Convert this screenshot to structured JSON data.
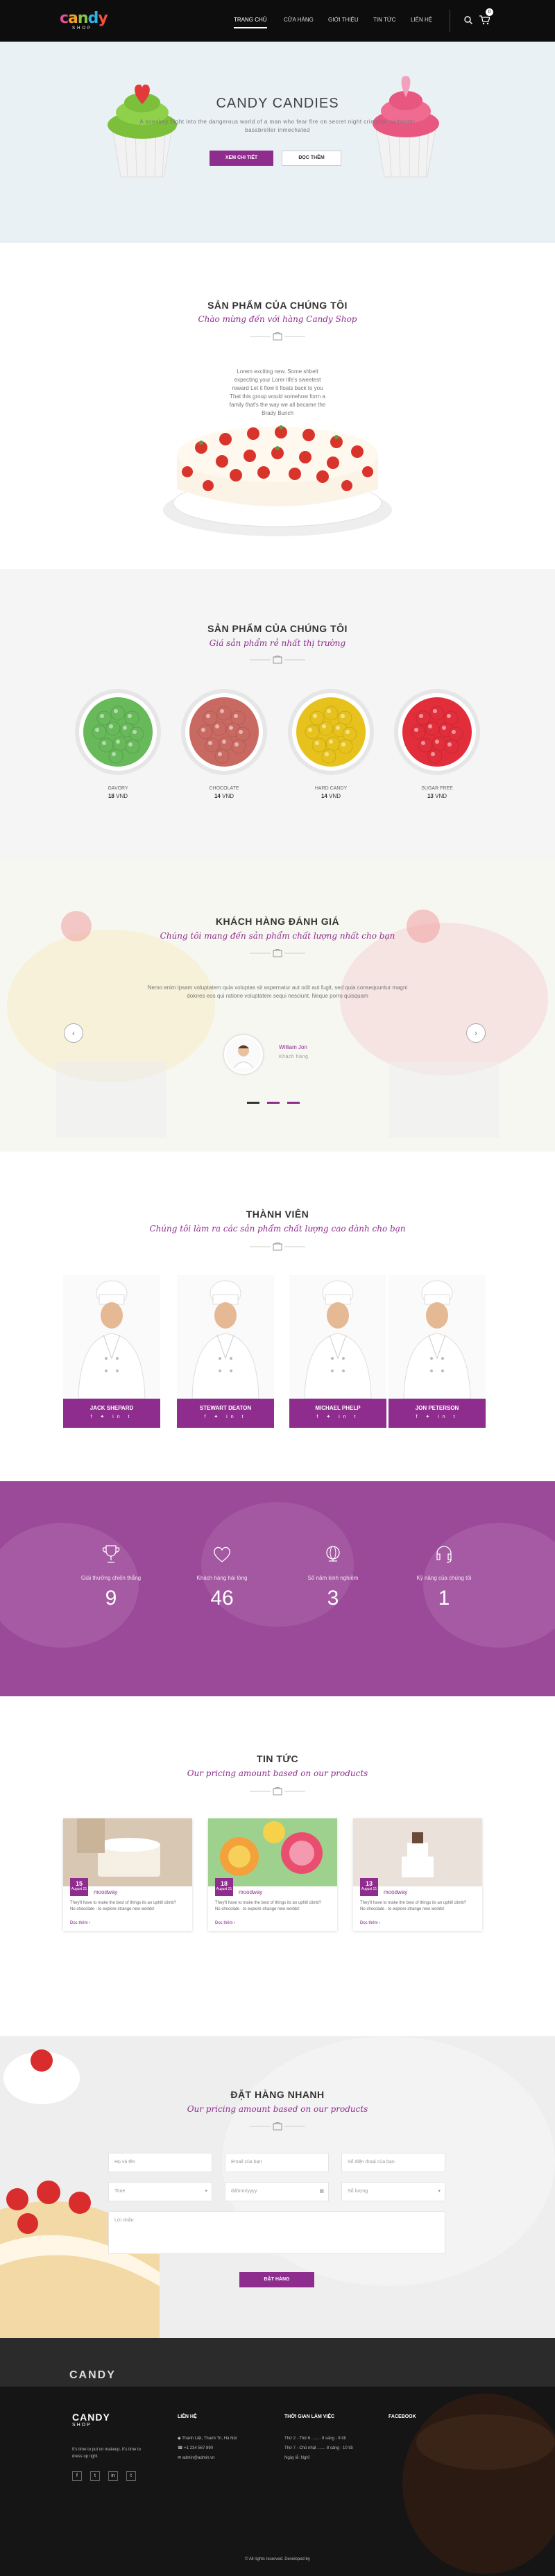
{
  "colors": {
    "brand": "#8f2d8e",
    "header": "#0d0d0d",
    "stats_bg": "#9a4a98",
    "footer": "#151515"
  },
  "header": {
    "logo": "Candy",
    "logo_sub": "SHOP",
    "nav": [
      "TRANG CHỦ",
      "CỬA HÀNG",
      "GIỚI THIỆU",
      "TIN TỨC",
      "LIÊN HỆ"
    ],
    "icons": [
      "search-icon",
      "cart-icon"
    ],
    "cart_count": "0"
  },
  "hero": {
    "title": "CANDY CANDIES",
    "subtitle": "A sneakey flight into the dangerous world of a man who fear fire on secret night crimebar saltwater bassbreller inmechated",
    "primary_button": "XEM CHI TIẾT",
    "secondary_button": "ĐỌC THÊM"
  },
  "products": {
    "title": "SẢN PHẨM CỦA CHÚNG TÔI",
    "subtitle": "Chào mừng đến với hàng Candy Shop",
    "description": "Lorem exciting new. Some shbelt expecting your Lorer life's sweetest reward Let it flow it floats back to you That this group would somehow form a family that's the way we all became the Brady Bunch"
  },
  "categories": {
    "title": "SẢN PHẨM CỦA CHÚNG TÔI",
    "subtitle": "Giá sản phẩm rẻ nhất thị trường",
    "currency": "VND",
    "items": [
      {
        "name": "GAVORY",
        "price": "18",
        "color": "#67b95a"
      },
      {
        "name": "CHOCOLATE",
        "price": "14",
        "color": "#c96a62"
      },
      {
        "name": "HARD CANDY",
        "price": "14",
        "color": "#e8c21c"
      },
      {
        "name": "SUGAR FREE",
        "price": "13",
        "color": "#e12e3a"
      }
    ]
  },
  "reviews": {
    "title": "KHÁCH HÀNG ĐÁNH GIÁ",
    "subtitle": "Chúng tôi mang đến sản phẩm chất lượng nhất cho bạn",
    "quote": "Nemo enim ipsam voluptatem quia voluptas sit aspernatur aut odit aut fugit, sed quia consequuntur magni dolores eos qui ratione voluptatem sequi nesciunt. Neque porro quisquam",
    "name": "William Jon",
    "role": "Khách hàng",
    "prev": "‹",
    "next": "›"
  },
  "team": {
    "title": "THÀNH VIÊN",
    "subtitle": "Chúng tôi làm ra các sản phẩm chất lượng cao dành cho bạn",
    "members": [
      {
        "name": "JACK SHEPARD"
      },
      {
        "name": "STEWART DEATON"
      },
      {
        "name": "MICHAEL PHELP"
      },
      {
        "name": "JON PETERSON"
      }
    ],
    "social": "f ✦ in t"
  },
  "stats": [
    {
      "label": "Giải thưởng chiến thắng",
      "value": "9",
      "icon": "trophy-icon"
    },
    {
      "label": "Khách hàng hài lòng",
      "value": "46",
      "icon": "heart-icon"
    },
    {
      "label": "Số năm kinh nghiệm",
      "value": "3",
      "icon": "globe-icon"
    },
    {
      "label": "Kỹ năng của chúng tôi",
      "value": "1",
      "icon": "headset-icon"
    }
  ],
  "news": {
    "title": "TIN TỨC",
    "subtitle": "Our pricing amount based on our products",
    "posts": [
      {
        "day": "15",
        "month": "August 21",
        "author": "moodway",
        "text": "They'll have to make the best of things its an uphill climb? No chocolate - to explore strange new worlds!",
        "more": "Đọc thêm ›"
      },
      {
        "day": "18",
        "month": "August 21",
        "author": "moodway",
        "text": "They'll have to make the best of things its an uphill climb? No chocolate - to explore strange new worlds!",
        "more": "Đọc thêm ›"
      },
      {
        "day": "13",
        "month": "August 21",
        "author": "moodway",
        "text": "They'll have to make the best of things its an uphill climb? No chocolate - to explore strange new worlds!",
        "more": "Đọc thêm ›"
      }
    ]
  },
  "order": {
    "title": "ĐẶT HÀNG NHANH",
    "subtitle": "Our pricing amount based on our products",
    "name_ph": "Họ và tên",
    "email_ph": "Email của bạn",
    "phone_ph": "Số điện thoại của bạn",
    "time": "Time",
    "date": "dd/mm/yyyy",
    "quantity": "Số lượng",
    "message_ph": "Lời nhắn",
    "submit": "ĐẶT HÀNG"
  },
  "footer": {
    "ghost": "CANDY",
    "brand": "CANDY",
    "brand_sub": "SHOP",
    "about": "It's time to put on makeup. It's time to dress up right.",
    "contact_title": "LIÊN HỆ",
    "contact": [
      "Thanh Liệt, Thanh Trì, Hà Nội",
      "+1 234 567 890",
      "admin@admin.vn"
    ],
    "hours_title": "THỜI GIAN LÀM VIỆC",
    "hours": [
      "Thứ 2 - Thứ 6 ........ 8 sáng - 9 tối",
      "Thứ 7 - Chủ nhật ....... 8 sáng - 10 tối",
      "Ngày lễ: Nghỉ"
    ],
    "facebook_title": "FACEBOOK",
    "copyright": "© All rights reserved. Developed by",
    "socials": [
      "f",
      "t",
      "in",
      "t"
    ]
  }
}
